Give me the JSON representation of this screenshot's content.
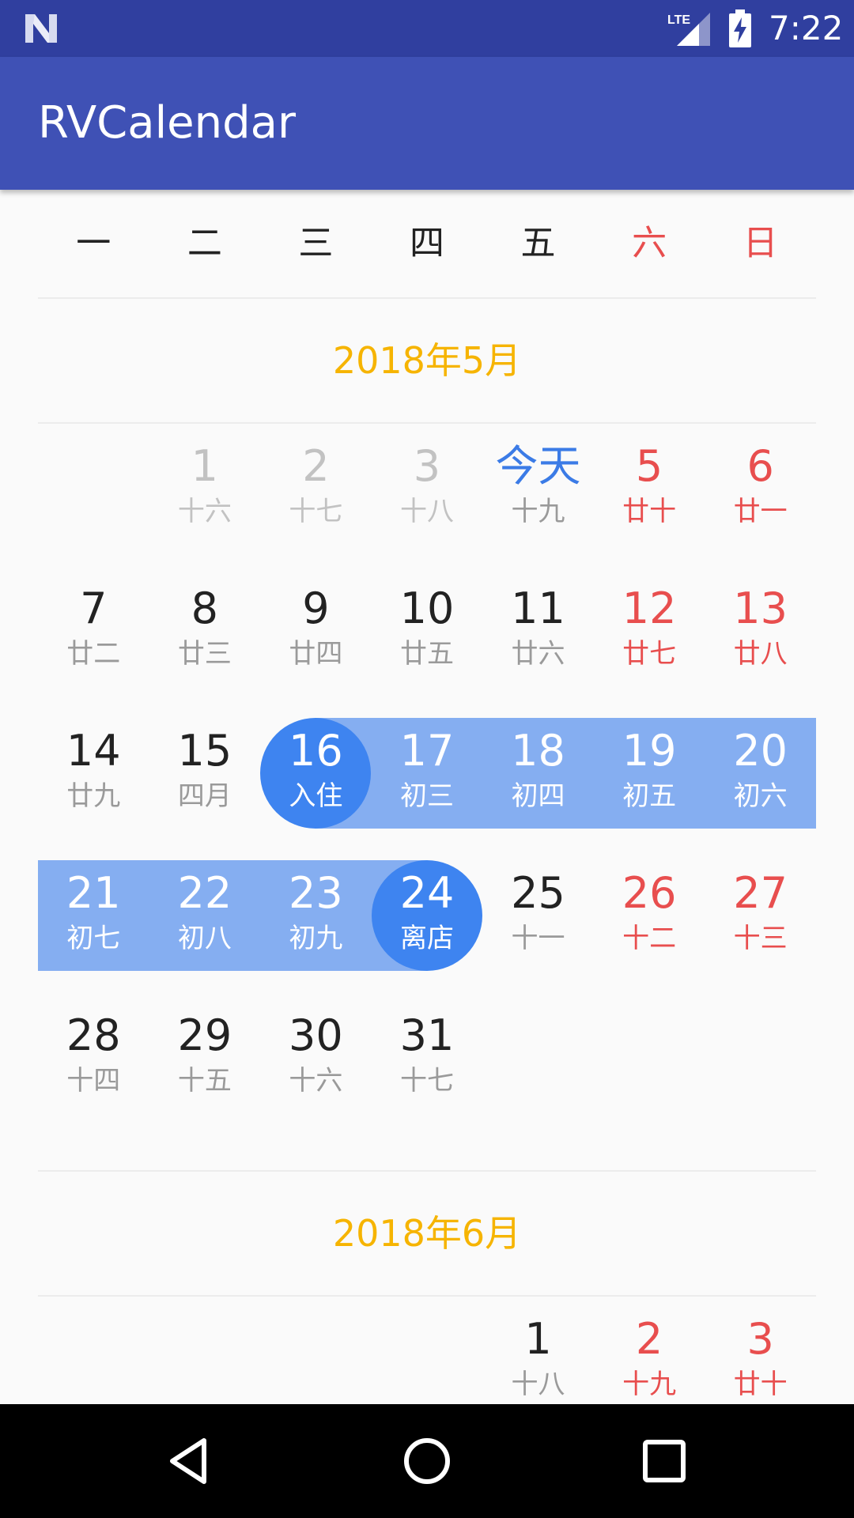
{
  "status_bar": {
    "time": "7:22",
    "network": "LTE"
  },
  "app_bar": {
    "title": "RVCalendar"
  },
  "weekdays": [
    {
      "label": "一",
      "weekend": false
    },
    {
      "label": "二",
      "weekend": false
    },
    {
      "label": "三",
      "weekend": false
    },
    {
      "label": "四",
      "weekend": false
    },
    {
      "label": "五",
      "weekend": false
    },
    {
      "label": "六",
      "weekend": true
    },
    {
      "label": "日",
      "weekend": true
    }
  ],
  "months": [
    {
      "title": "2018年5月",
      "weeks": [
        {
          "range": null,
          "days": [
            null,
            {
              "day": "1",
              "sub": "十六",
              "state": "past"
            },
            {
              "day": "2",
              "sub": "十七",
              "state": "past"
            },
            {
              "day": "3",
              "sub": "十八",
              "state": "past"
            },
            {
              "day": "今天",
              "sub": "十九",
              "state": "today"
            },
            {
              "day": "5",
              "sub": "廿十",
              "weekend": true
            },
            {
              "day": "6",
              "sub": "廿一",
              "weekend": true
            }
          ]
        },
        {
          "range": null,
          "days": [
            {
              "day": "7",
              "sub": "廿二"
            },
            {
              "day": "8",
              "sub": "廿三"
            },
            {
              "day": "9",
              "sub": "廿四"
            },
            {
              "day": "10",
              "sub": "廿五"
            },
            {
              "day": "11",
              "sub": "廿六"
            },
            {
              "day": "12",
              "sub": "廿七",
              "weekend": true
            },
            {
              "day": "13",
              "sub": "廿八",
              "weekend": true
            }
          ]
        },
        {
          "range": {
            "from_col": 2,
            "to_col": 6,
            "starts_with_circle": true,
            "ends_with_circle": false
          },
          "days": [
            {
              "day": "14",
              "sub": "廿九"
            },
            {
              "day": "15",
              "sub": "四月"
            },
            {
              "day": "16",
              "sub": "入住",
              "state": "range-start"
            },
            {
              "day": "17",
              "sub": "初三",
              "state": "in-range"
            },
            {
              "day": "18",
              "sub": "初四",
              "state": "in-range"
            },
            {
              "day": "19",
              "sub": "初五",
              "state": "in-range"
            },
            {
              "day": "20",
              "sub": "初六",
              "state": "in-range"
            }
          ]
        },
        {
          "range": {
            "from_col": 0,
            "to_col": 3,
            "starts_with_circle": false,
            "ends_with_circle": true
          },
          "days": [
            {
              "day": "21",
              "sub": "初七",
              "state": "in-range"
            },
            {
              "day": "22",
              "sub": "初八",
              "state": "in-range"
            },
            {
              "day": "23",
              "sub": "初九",
              "state": "in-range"
            },
            {
              "day": "24",
              "sub": "离店",
              "state": "range-end"
            },
            {
              "day": "25",
              "sub": "十一"
            },
            {
              "day": "26",
              "sub": "十二",
              "weekend": true
            },
            {
              "day": "27",
              "sub": "十三",
              "weekend": true
            }
          ]
        },
        {
          "range": null,
          "days": [
            {
              "day": "28",
              "sub": "十四"
            },
            {
              "day": "29",
              "sub": "十五"
            },
            {
              "day": "30",
              "sub": "十六"
            },
            {
              "day": "31",
              "sub": "十七"
            },
            null,
            null,
            null
          ]
        }
      ]
    },
    {
      "title": "2018年6月",
      "weeks": [
        {
          "range": null,
          "days": [
            null,
            null,
            null,
            null,
            {
              "day": "1",
              "sub": "十八"
            },
            {
              "day": "2",
              "sub": "十九",
              "weekend": true
            },
            {
              "day": "3",
              "sub": "廿十",
              "weekend": true
            }
          ]
        }
      ]
    }
  ],
  "nav_bar": {
    "buttons": [
      "back-icon",
      "home-icon",
      "recents-icon"
    ]
  }
}
